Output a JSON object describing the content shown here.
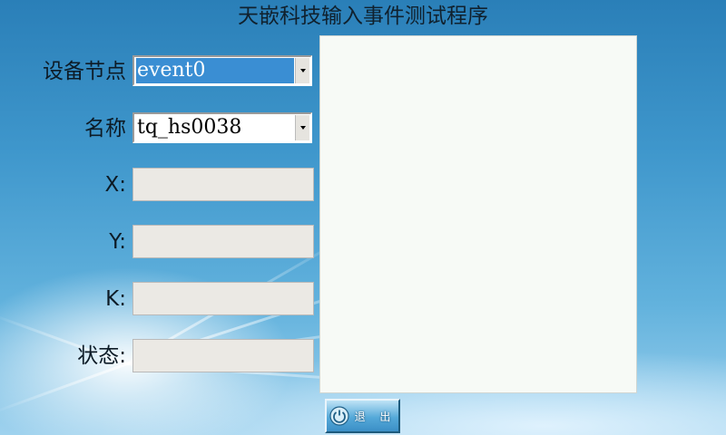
{
  "app": {
    "title": "天嵌科技输入事件测试程序"
  },
  "form": {
    "device_label": "设备节点",
    "device_value": "event0",
    "name_label": "名称",
    "name_value": "tq_hs0038",
    "x_label": "X:",
    "x_value": "",
    "y_label": "Y:",
    "y_value": "",
    "k_label": "K:",
    "k_value": "",
    "status_label": "状态:",
    "status_value": ""
  },
  "output": {
    "text": ""
  },
  "buttons": {
    "exit_label": "退 出"
  }
}
